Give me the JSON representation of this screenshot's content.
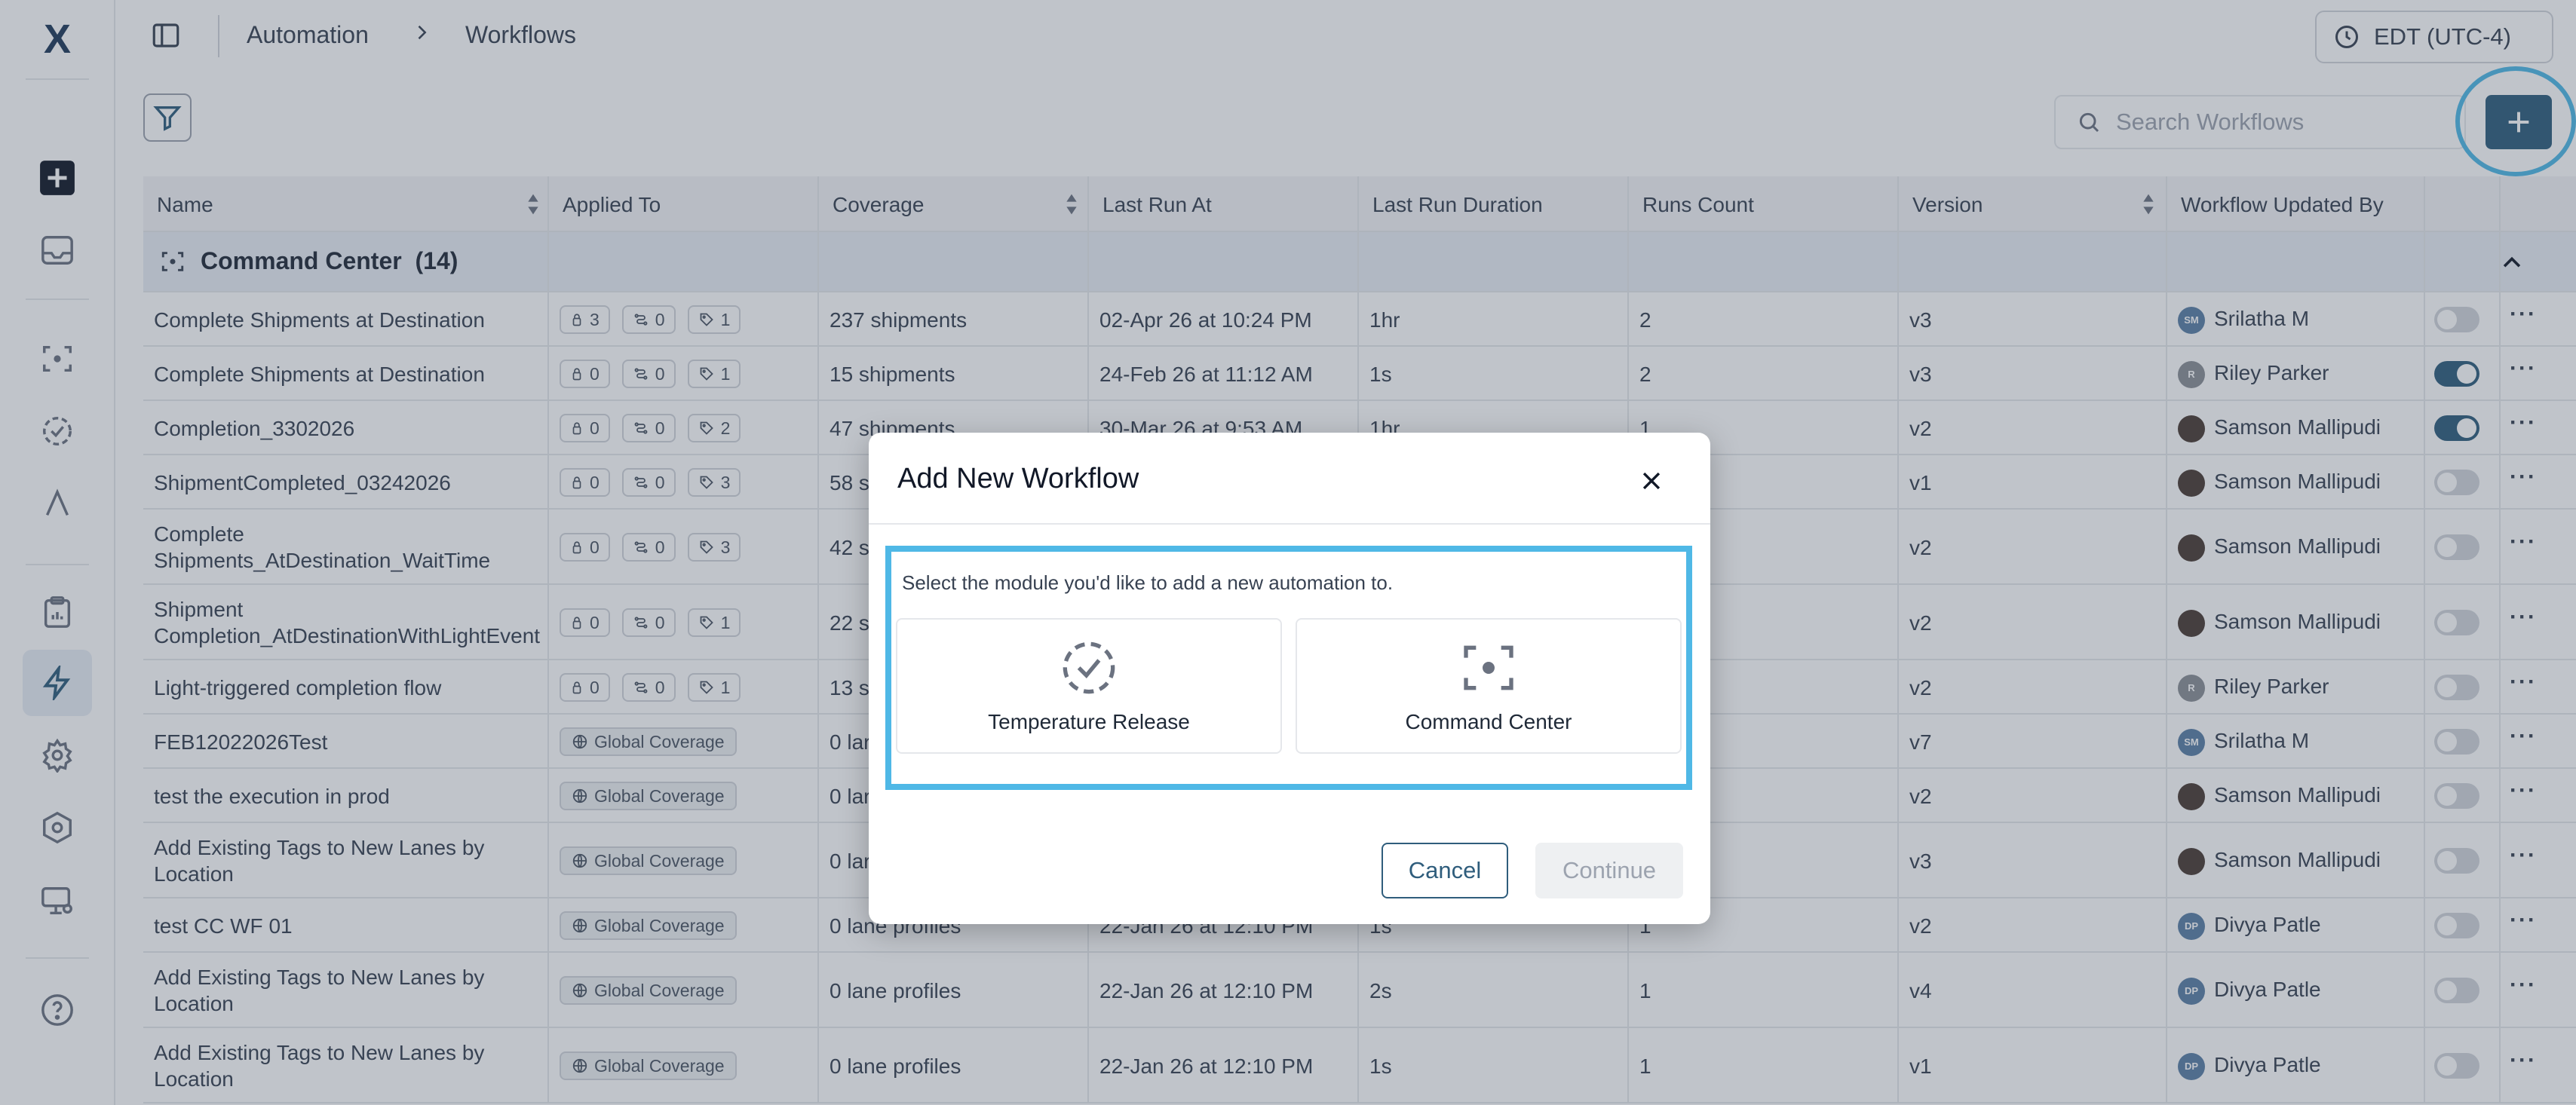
{
  "app": {
    "logo_text": "X"
  },
  "breadcrumb": {
    "parent": "Automation",
    "current": "Workflows"
  },
  "timezone": {
    "label": "EDT (UTC-4)"
  },
  "search": {
    "placeholder": "Search Workflows"
  },
  "table": {
    "columns": [
      "Name",
      "Applied To",
      "Coverage",
      "Last Run At",
      "Last Run Duration",
      "Runs Count",
      "Version",
      "Workflow Updated By"
    ],
    "group": {
      "title": "Command Center",
      "count": "(14)"
    },
    "rows": [
      {
        "name": "Complete Shipments at Destination",
        "applied": [
          "3",
          "0",
          "1"
        ],
        "coverage": "237 shipments",
        "last_run": "02-Apr 26 at 10:24 PM",
        "duration": "1hr",
        "runs": "2",
        "version": "v3",
        "user": "Srilatha M",
        "initials": "SM",
        "toggle": false
      },
      {
        "name": "Complete Shipments at Destination",
        "applied": [
          "0",
          "0",
          "1"
        ],
        "coverage": "15 shipments",
        "last_run": "24-Feb 26 at 11:12 AM",
        "duration": "1s",
        "runs": "2",
        "version": "v3",
        "user": "Riley Parker",
        "initials": "R",
        "toggle": true
      },
      {
        "name": "Completion_3302026",
        "applied": [
          "0",
          "0",
          "2"
        ],
        "coverage": "47 shipments",
        "last_run": "30-Mar 26 at 9:53 AM",
        "duration": "1hr",
        "runs": "1",
        "version": "v2",
        "user": "Samson Mallipudi",
        "initials": "",
        "toggle": true
      },
      {
        "name": "ShipmentCompleted_03242026",
        "applied": [
          "0",
          "0",
          "3"
        ],
        "coverage": "58 s",
        "last_run": "",
        "duration": "",
        "runs": "",
        "version": "v1",
        "user": "Samson Mallipudi",
        "initials": "",
        "toggle": false
      },
      {
        "name": "Complete Shipments_AtDestination_WaitTime",
        "applied": [
          "0",
          "0",
          "3"
        ],
        "coverage": "42 s",
        "last_run": "",
        "duration": "",
        "runs": "",
        "version": "v2",
        "user": "Samson Mallipudi",
        "initials": "",
        "toggle": false
      },
      {
        "name": "Shipment Completion_AtDestinationWithLightEvent",
        "applied": [
          "0",
          "0",
          "1"
        ],
        "coverage": "22 s",
        "last_run": "",
        "duration": "",
        "runs": "",
        "version": "v2",
        "user": "Samson Mallipudi",
        "initials": "",
        "toggle": false
      },
      {
        "name": "Light-triggered completion flow",
        "applied": [
          "0",
          "0",
          "1"
        ],
        "coverage": "13 s",
        "last_run": "",
        "duration": "",
        "runs": "",
        "version": "v2",
        "user": "Riley Parker",
        "initials": "R",
        "toggle": false
      },
      {
        "name": "FEB12022026Test",
        "global": "Global Coverage",
        "coverage": "0 lar",
        "last_run": "",
        "duration": "",
        "runs": "",
        "version": "v7",
        "user": "Srilatha M",
        "initials": "SM",
        "toggle": false
      },
      {
        "name": "test the execution in prod",
        "global": "Global Coverage",
        "coverage": "0 lar",
        "last_run": "",
        "duration": "",
        "runs": "",
        "version": "v2",
        "user": "Samson Mallipudi",
        "initials": "",
        "toggle": false
      },
      {
        "name": "Add Existing Tags to New Lanes by Location",
        "global": "Global Coverage",
        "coverage": "0 lar",
        "last_run": "",
        "duration": "",
        "runs": "",
        "version": "v3",
        "user": "Samson Mallipudi",
        "initials": "",
        "toggle": false
      },
      {
        "name": "test CC WF 01",
        "global": "Global Coverage",
        "coverage": "0 lane profiles",
        "last_run": "22-Jan 26 at 12:10 PM",
        "duration": "1s",
        "runs": "1",
        "version": "v2",
        "user": "Divya Patle",
        "initials": "DP",
        "toggle": false
      },
      {
        "name": "Add Existing Tags to New Lanes by Location",
        "global": "Global Coverage",
        "coverage": "0 lane profiles",
        "last_run": "22-Jan 26 at 12:10 PM",
        "duration": "2s",
        "runs": "1",
        "version": "v4",
        "user": "Divya Patle",
        "initials": "DP",
        "toggle": false
      },
      {
        "name": "Add Existing Tags to New Lanes by Location",
        "global": "Global Coverage",
        "coverage": "0 lane profiles",
        "last_run": "22-Jan 26 at 12:10 PM",
        "duration": "1s",
        "runs": "1",
        "version": "v1",
        "user": "Divya Patle",
        "initials": "DP",
        "toggle": false
      }
    ]
  },
  "modal": {
    "title": "Add New Workflow",
    "description": "Select the module you'd like to add a new automation to.",
    "options": [
      {
        "label": "Temperature Release",
        "icon": "dashed-check-circle-icon"
      },
      {
        "label": "Command Center",
        "icon": "scan-focus-icon"
      }
    ],
    "cancel_label": "Cancel",
    "continue_label": "Continue"
  },
  "colors": {
    "accent": "#2f5d7c",
    "highlight": "#4fb8e6"
  }
}
